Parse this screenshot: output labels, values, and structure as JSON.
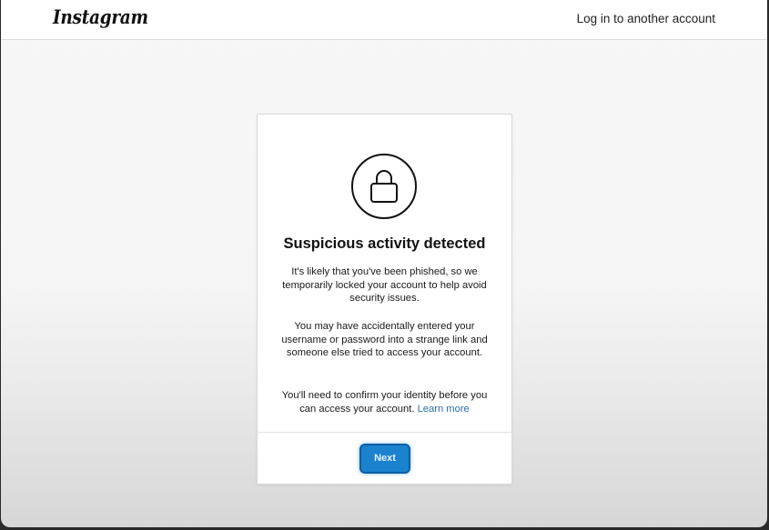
{
  "header": {
    "logo_text": "Instagram",
    "login_other_label": "Log in to another account"
  },
  "card": {
    "icon": "lock-icon",
    "title": "Suspicious activity detected",
    "paragraph1": "It's likely that you've been phished, so we temporarily locked your account to help avoid security issues.",
    "paragraph2": "You may have accidentally entered your username or password into a strange link and someone else tried to access your account.",
    "paragraph3": "You'll need to confirm your identity before you can access your account.",
    "learn_more_label": "Learn more",
    "next_label": "Next"
  },
  "colors": {
    "accent": "#1a82cf",
    "link": "#2a6fb0"
  }
}
